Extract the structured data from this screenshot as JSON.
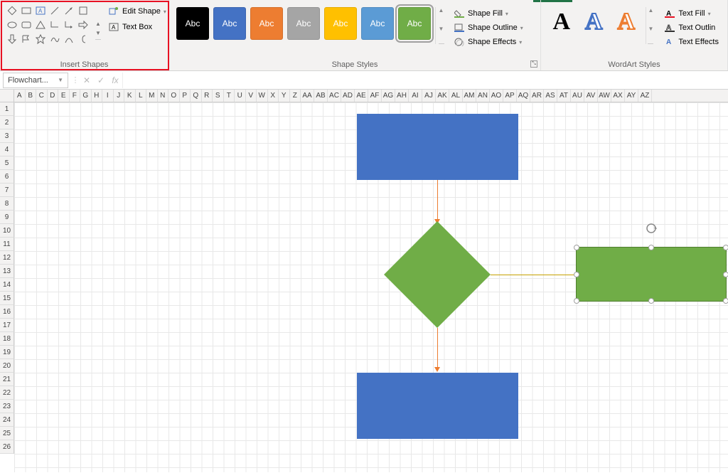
{
  "ribbon": {
    "insert_shapes_label": "Insert Shapes",
    "edit_shape_label": "Edit Shape",
    "text_box_label": "Text Box",
    "shape_styles_label": "Shape Styles",
    "shape_fill_label": "Shape Fill",
    "shape_outline_label": "Shape Outline",
    "shape_effects_label": "Shape Effects",
    "wordart_label": "WordArt Styles",
    "text_fill_label": "Text Fill",
    "text_outline_label": "Text Outlin",
    "text_effects_label": "Text Effects",
    "style_swatches": [
      {
        "bg": "#000000",
        "label": "Abc"
      },
      {
        "bg": "#4472c4",
        "label": "Abc"
      },
      {
        "bg": "#ed7d31",
        "label": "Abc"
      },
      {
        "bg": "#a5a5a5",
        "label": "Abc"
      },
      {
        "bg": "#ffc000",
        "label": "Abc"
      },
      {
        "bg": "#5b9bd5",
        "label": "Abc"
      },
      {
        "bg": "#70ad47",
        "label": "Abc",
        "selected": true
      }
    ],
    "wordart_samples": [
      "A",
      "A",
      "A"
    ]
  },
  "name_box": "Flowchart...",
  "columns_single": [
    "A",
    "B",
    "C",
    "D",
    "E",
    "F",
    "G",
    "H",
    "I",
    "J",
    "K",
    "L",
    "M",
    "N",
    "O",
    "P",
    "Q",
    "R",
    "S",
    "T",
    "U",
    "V",
    "W",
    "X",
    "Y",
    "Z"
  ],
  "columns_double": [
    "AA",
    "AB",
    "AC",
    "AD",
    "AE",
    "AF",
    "AG",
    "AH",
    "AI",
    "AJ",
    "AK",
    "AL",
    "AM",
    "AN",
    "AO",
    "AP",
    "AQ",
    "AR",
    "AS",
    "AT",
    "AU",
    "AV",
    "AW",
    "AX",
    "AY",
    "AZ"
  ],
  "rows": [
    "1",
    "2",
    "3",
    "4",
    "5",
    "6",
    "7",
    "8",
    "9",
    "10",
    "11",
    "12",
    "13",
    "14",
    "15",
    "16",
    "17",
    "18",
    "19",
    "20",
    "21",
    "22",
    "23",
    "24",
    "25",
    "26"
  ],
  "shapes": {
    "process1": {
      "type": "rect",
      "fill": "#4472c4"
    },
    "decision": {
      "type": "diamond",
      "fill": "#70ad47"
    },
    "process2": {
      "type": "rect",
      "fill": "#4472c4"
    },
    "selected_process": {
      "type": "rect",
      "fill": "#70ad47",
      "selected": true
    }
  }
}
